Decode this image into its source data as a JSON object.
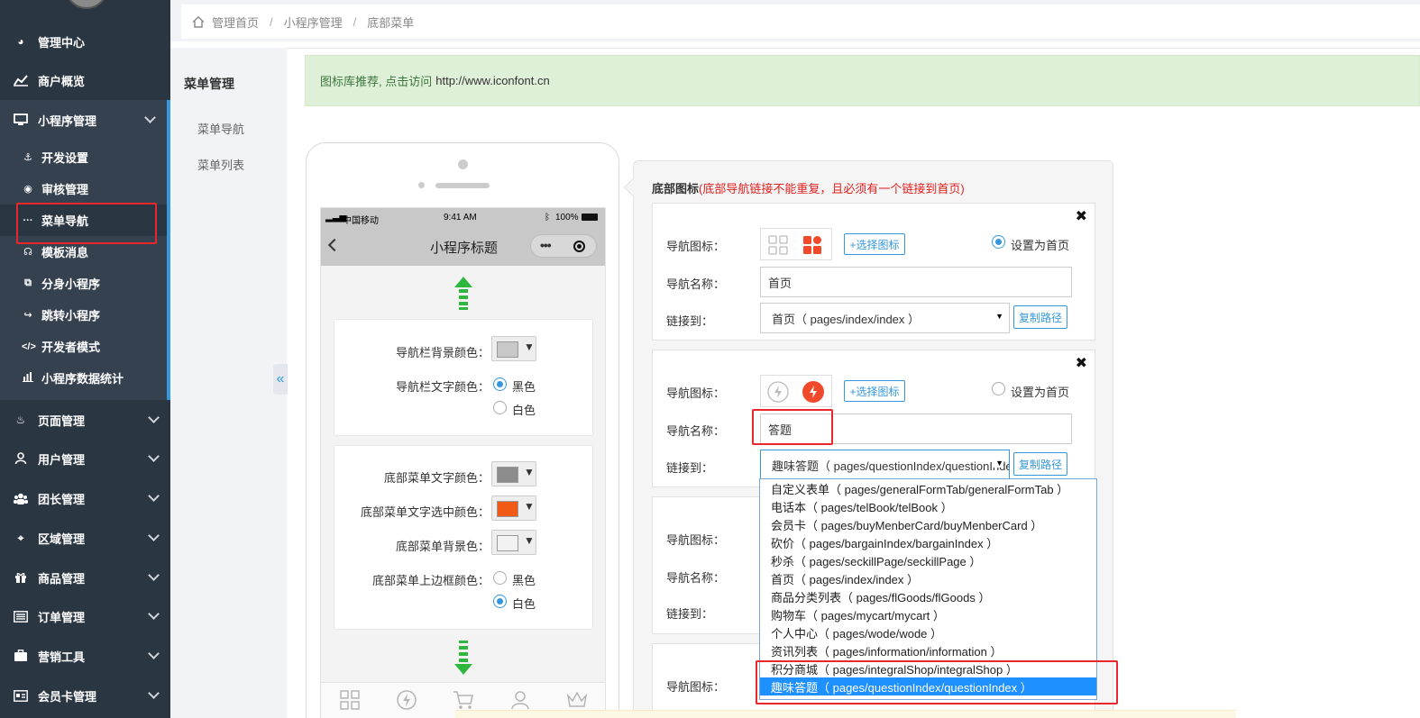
{
  "sidebar": {
    "items": [
      {
        "label": "管理中心"
      },
      {
        "label": "商户概览"
      },
      {
        "label": "小程序管理"
      },
      {
        "label": "页面管理"
      },
      {
        "label": "用户管理"
      },
      {
        "label": "团长管理"
      },
      {
        "label": "区域管理"
      },
      {
        "label": "商品管理"
      },
      {
        "label": "订单管理"
      },
      {
        "label": "营销工具"
      },
      {
        "label": "会员卡管理"
      }
    ],
    "sub_items": [
      {
        "label": "开发设置"
      },
      {
        "label": "审核管理"
      },
      {
        "label": "菜单导航"
      },
      {
        "label": "模板消息"
      },
      {
        "label": "分身小程序"
      },
      {
        "label": "跳转小程序"
      },
      {
        "label": "开发者模式"
      },
      {
        "label": "小程序数据统计"
      }
    ]
  },
  "breadcrumb": [
    "管理首页",
    "小程序管理",
    "底部菜单"
  ],
  "menu2": {
    "title": "菜单管理",
    "links": [
      "菜单导航",
      "菜单列表"
    ],
    "collapse": "«"
  },
  "alert": {
    "text": "图标库推荐, 点击访问",
    "url": "http://www.iconfont.cn"
  },
  "phone": {
    "carrier": "中国移动",
    "time": "9:41 AM",
    "battery": "100%",
    "title": "小程序标题",
    "nav_bg_label": "导航栏背景颜色：",
    "nav_text_label": "导航栏文字颜色：",
    "black": "黑色",
    "white": "白色",
    "menu_text_label": "底部菜单文字颜色：",
    "menu_text_sel_label": "底部菜单文字选中颜色：",
    "menu_bg_label": "底部菜单背景色：",
    "menu_border_label": "底部菜单上边框颜色：",
    "colors": {
      "nav_bg": "#c8c8c8",
      "menu_text": "#8c8c8c",
      "menu_text_sel": "#f05a14",
      "menu_bg": "#f2f2f2"
    }
  },
  "panel": {
    "head": "底部图标",
    "warn": "(底部导航链接不能重复，且必须有一个链接到首页)",
    "icon_label": "导航图标：",
    "name_label": "导航名称：",
    "link_label": "链接到：",
    "choose_icon": "+选择图标",
    "set_home": "设置为首页",
    "copy_path": "复制路径",
    "close": "✖",
    "card1": {
      "name": "首页",
      "link": "首页（ pages/index/index ）"
    },
    "card2": {
      "name": "答题",
      "link": "趣味答题（ pages/questionIndex/questionIndex ）"
    }
  },
  "dropdown": [
    "自定义表单（ pages/generalFormTab/generalFormTab ）",
    "电话本（ pages/telBook/telBook ）",
    "会员卡（ pages/buyMenberCard/buyMenberCard ）",
    "砍价（ pages/bargainIndex/bargainIndex ）",
    "秒杀（ pages/seckillPage/seckillPage ）",
    "首页（ pages/index/index ）",
    "商品分类列表（ pages/flGoods/flGoods ）",
    "购物车（ pages/mycart/mycart ）",
    "个人中心（ pages/wode/wode ）",
    "资讯列表（ pages/information/information ）",
    "积分商城（ pages/integralShop/integralShop ）",
    "趣味答题（ pages/questionIndex/questionIndex ）"
  ],
  "colors": {
    "accent": "#3598dc",
    "highlight": "#e8262b",
    "selected": "#1e90ff",
    "sidebar_bg": "#2b3643"
  }
}
